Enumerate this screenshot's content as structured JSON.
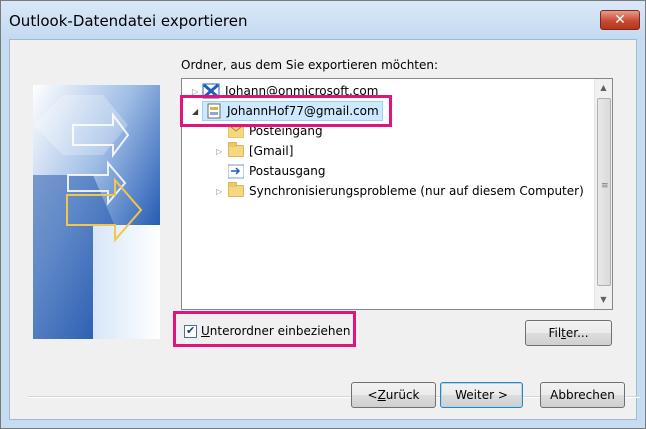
{
  "window": {
    "title": "Outlook-Datendatei exportieren",
    "close_symbol": "✕"
  },
  "prompt": "Ordner, aus dem Sie exportieren möchten:",
  "tree": {
    "nodes": [
      {
        "label": "Johann@onmicrosoft.com",
        "icon": "exchange-account-icon",
        "expander": "▷"
      },
      {
        "label": "JohannHof77@gmail.com",
        "icon": "data-file-icon",
        "expander": "◢"
      },
      {
        "label": "Posteingang",
        "icon": "inbox-folder-icon",
        "expander": ""
      },
      {
        "label": "[Gmail]",
        "icon": "folder-icon",
        "expander": "▷"
      },
      {
        "label": "Postausgang",
        "icon": "outbox-folder-icon",
        "expander": ""
      },
      {
        "label": "Synchronisierungsprobleme (nur auf diesem Computer)",
        "icon": "folder-icon",
        "expander": "▷"
      }
    ],
    "scroll_up": "▲",
    "scroll_down": "▼"
  },
  "checkbox": {
    "label_underlined": "U",
    "label_rest": "nterordner einbeziehen",
    "checked": true
  },
  "buttons": {
    "filter_underlined": "t",
    "filter_pre": "Fil",
    "filter_post": "er...",
    "back_pre": "< ",
    "back_underlined": "Z",
    "back_post": "urück",
    "next": "Weiter >",
    "cancel": "Abbrechen"
  },
  "colors": {
    "highlight": "#e0147c",
    "selection": "#cde8ff",
    "titlebar": "#c6dcf2"
  }
}
